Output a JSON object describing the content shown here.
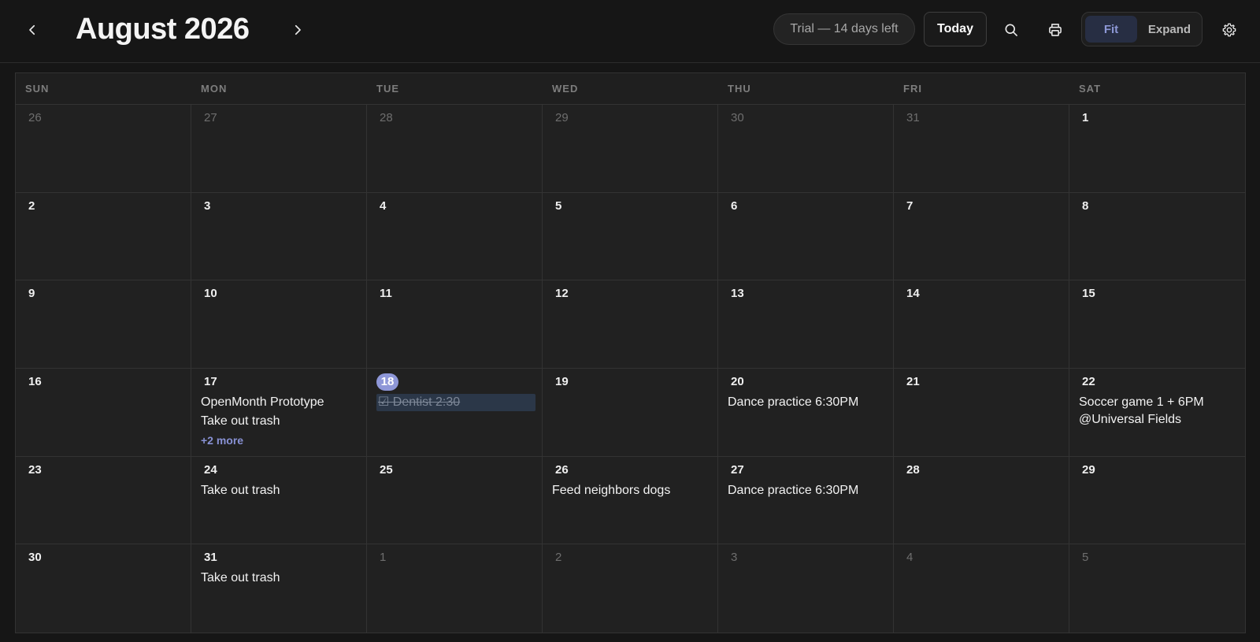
{
  "header": {
    "month_title": "August 2026",
    "trial_label": "Trial — 14 days left",
    "today_label": "Today",
    "view_fit_label": "Fit",
    "view_expand_label": "Expand",
    "icons": {
      "prev": "chevron-left-icon",
      "next": "chevron-right-icon",
      "search": "search-icon",
      "print": "printer-icon",
      "settings": "gear-icon"
    }
  },
  "colors": {
    "accent": "#8e97d8",
    "background": "#161616",
    "cell": "#212121"
  },
  "weekdays": [
    "SUN",
    "MON",
    "TUE",
    "WED",
    "THU",
    "FRI",
    "SAT"
  ],
  "weeks": [
    [
      {
        "day": "26",
        "other": true,
        "events": []
      },
      {
        "day": "27",
        "other": true,
        "events": []
      },
      {
        "day": "28",
        "other": true,
        "events": []
      },
      {
        "day": "29",
        "other": true,
        "events": []
      },
      {
        "day": "30",
        "other": true,
        "events": []
      },
      {
        "day": "31",
        "other": true,
        "events": []
      },
      {
        "day": "1",
        "events": []
      }
    ],
    [
      {
        "day": "2",
        "events": []
      },
      {
        "day": "3",
        "events": []
      },
      {
        "day": "4",
        "events": []
      },
      {
        "day": "5",
        "events": []
      },
      {
        "day": "6",
        "events": []
      },
      {
        "day": "7",
        "events": []
      },
      {
        "day": "8",
        "events": []
      }
    ],
    [
      {
        "day": "9",
        "events": []
      },
      {
        "day": "10",
        "events": []
      },
      {
        "day": "11",
        "events": []
      },
      {
        "day": "12",
        "events": []
      },
      {
        "day": "13",
        "events": []
      },
      {
        "day": "14",
        "events": []
      },
      {
        "day": "15",
        "events": []
      }
    ],
    [
      {
        "day": "16",
        "events": []
      },
      {
        "day": "17",
        "events": [
          {
            "title": "OpenMonth Prototype"
          },
          {
            "title": "Take out trash"
          }
        ],
        "more": "+2 more"
      },
      {
        "day": "18",
        "today": true,
        "events": [
          {
            "title": "☑ Dentist 2:30",
            "done": true
          }
        ]
      },
      {
        "day": "19",
        "events": []
      },
      {
        "day": "20",
        "events": [
          {
            "title": "Dance practice 6:30PM"
          }
        ]
      },
      {
        "day": "21",
        "events": []
      },
      {
        "day": "22",
        "events": [
          {
            "title": "Soccer game 1 + 6PM @Universal Fields"
          }
        ]
      }
    ],
    [
      {
        "day": "23",
        "events": []
      },
      {
        "day": "24",
        "events": [
          {
            "title": "Take out trash"
          }
        ]
      },
      {
        "day": "25",
        "events": []
      },
      {
        "day": "26",
        "events": [
          {
            "title": "Feed neighbors dogs"
          }
        ]
      },
      {
        "day": "27",
        "events": [
          {
            "title": "Dance practice 6:30PM"
          }
        ]
      },
      {
        "day": "28",
        "events": []
      },
      {
        "day": "29",
        "events": []
      }
    ],
    [
      {
        "day": "30",
        "events": []
      },
      {
        "day": "31",
        "events": [
          {
            "title": "Take out trash"
          }
        ]
      },
      {
        "day": "1",
        "other": true,
        "events": []
      },
      {
        "day": "2",
        "other": true,
        "events": []
      },
      {
        "day": "3",
        "other": true,
        "events": []
      },
      {
        "day": "4",
        "other": true,
        "events": []
      },
      {
        "day": "5",
        "other": true,
        "events": []
      }
    ]
  ]
}
